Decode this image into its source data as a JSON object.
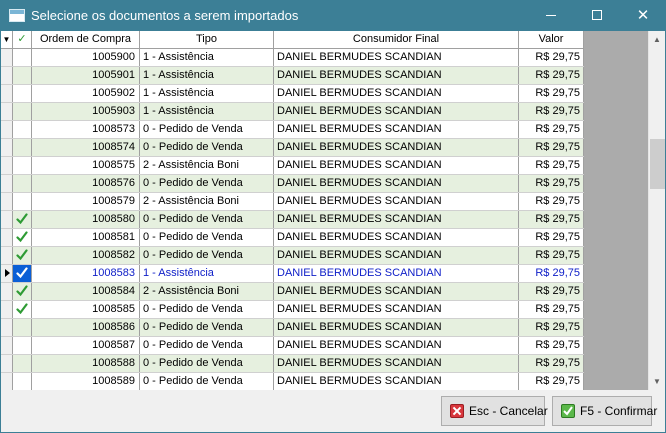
{
  "window": {
    "title": "Selecione os documentos a serem importados"
  },
  "grid": {
    "headers": {
      "sort_marker": "▼",
      "check": "✓",
      "ordem": "Ordem de Compra",
      "tipo": "Tipo",
      "consumidor": "Consumidor Final",
      "valor": "Valor"
    },
    "rows": [
      {
        "ordem": "1005900",
        "tipo": "1 - Assistência",
        "consumidor": "DANIEL BERMUDES SCANDIAN",
        "valor": "R$ 29,75",
        "checked": false
      },
      {
        "ordem": "1005901",
        "tipo": "1 - Assistência",
        "consumidor": "DANIEL BERMUDES SCANDIAN",
        "valor": "R$ 29,75",
        "checked": false
      },
      {
        "ordem": "1005902",
        "tipo": "1 - Assistência",
        "consumidor": "DANIEL BERMUDES SCANDIAN",
        "valor": "R$ 29,75",
        "checked": false
      },
      {
        "ordem": "1005903",
        "tipo": "1 - Assistência",
        "consumidor": "DANIEL BERMUDES SCANDIAN",
        "valor": "R$ 29,75",
        "checked": false
      },
      {
        "ordem": "1008573",
        "tipo": "0 - Pedido de Venda",
        "consumidor": "DANIEL BERMUDES SCANDIAN",
        "valor": "R$ 29,75",
        "checked": false
      },
      {
        "ordem": "1008574",
        "tipo": "0 - Pedido de Venda",
        "consumidor": "DANIEL BERMUDES SCANDIAN",
        "valor": "R$ 29,75",
        "checked": false
      },
      {
        "ordem": "1008575",
        "tipo": "2 - Assistência Boni",
        "consumidor": "DANIEL BERMUDES SCANDIAN",
        "valor": "R$ 29,75",
        "checked": false
      },
      {
        "ordem": "1008576",
        "tipo": "0 - Pedido de Venda",
        "consumidor": "DANIEL BERMUDES SCANDIAN",
        "valor": "R$ 29,75",
        "checked": false
      },
      {
        "ordem": "1008579",
        "tipo": "2 - Assistência Boni",
        "consumidor": "DANIEL BERMUDES SCANDIAN",
        "valor": "R$ 29,75",
        "checked": false
      },
      {
        "ordem": "1008580",
        "tipo": "0 - Pedido de Venda",
        "consumidor": "DANIEL BERMUDES SCANDIAN",
        "valor": "R$ 29,75",
        "checked": true
      },
      {
        "ordem": "1008581",
        "tipo": "0 - Pedido de Venda",
        "consumidor": "DANIEL BERMUDES SCANDIAN",
        "valor": "R$ 29,75",
        "checked": true
      },
      {
        "ordem": "1008582",
        "tipo": "0 - Pedido de Venda",
        "consumidor": "DANIEL BERMUDES SCANDIAN",
        "valor": "R$ 29,75",
        "checked": true
      },
      {
        "ordem": "1008583",
        "tipo": "1 - Assistência",
        "consumidor": "DANIEL BERMUDES SCANDIAN",
        "valor": "R$ 29,75",
        "checked": true,
        "selected": true
      },
      {
        "ordem": "1008584",
        "tipo": "2 - Assistência Boni",
        "consumidor": "DANIEL BERMUDES SCANDIAN",
        "valor": "R$ 29,75",
        "checked": true
      },
      {
        "ordem": "1008585",
        "tipo": "0 - Pedido de Venda",
        "consumidor": "DANIEL BERMUDES SCANDIAN",
        "valor": "R$ 29,75",
        "checked": true
      },
      {
        "ordem": "1008586",
        "tipo": "0 - Pedido de Venda",
        "consumidor": "DANIEL BERMUDES SCANDIAN",
        "valor": "R$ 29,75",
        "checked": false
      },
      {
        "ordem": "1008587",
        "tipo": "0 - Pedido de Venda",
        "consumidor": "DANIEL BERMUDES SCANDIAN",
        "valor": "R$ 29,75",
        "checked": false
      },
      {
        "ordem": "1008588",
        "tipo": "0 - Pedido de Venda",
        "consumidor": "DANIEL BERMUDES SCANDIAN",
        "valor": "R$ 29,75",
        "checked": false
      },
      {
        "ordem": "1008589",
        "tipo": "0 - Pedido de Venda",
        "consumidor": "DANIEL BERMUDES SCANDIAN",
        "valor": "R$ 29,75",
        "checked": false
      }
    ]
  },
  "buttons": {
    "cancel_label": "Esc - Cancelar",
    "confirm_label": "F5 - Confirmar"
  },
  "colors": {
    "titlebar": "#3c7f96",
    "row_alt": "#e6f0df",
    "check": "#2e9b34",
    "selected_text": "#1020c8",
    "selected_check_bg": "#0b5fd6"
  }
}
